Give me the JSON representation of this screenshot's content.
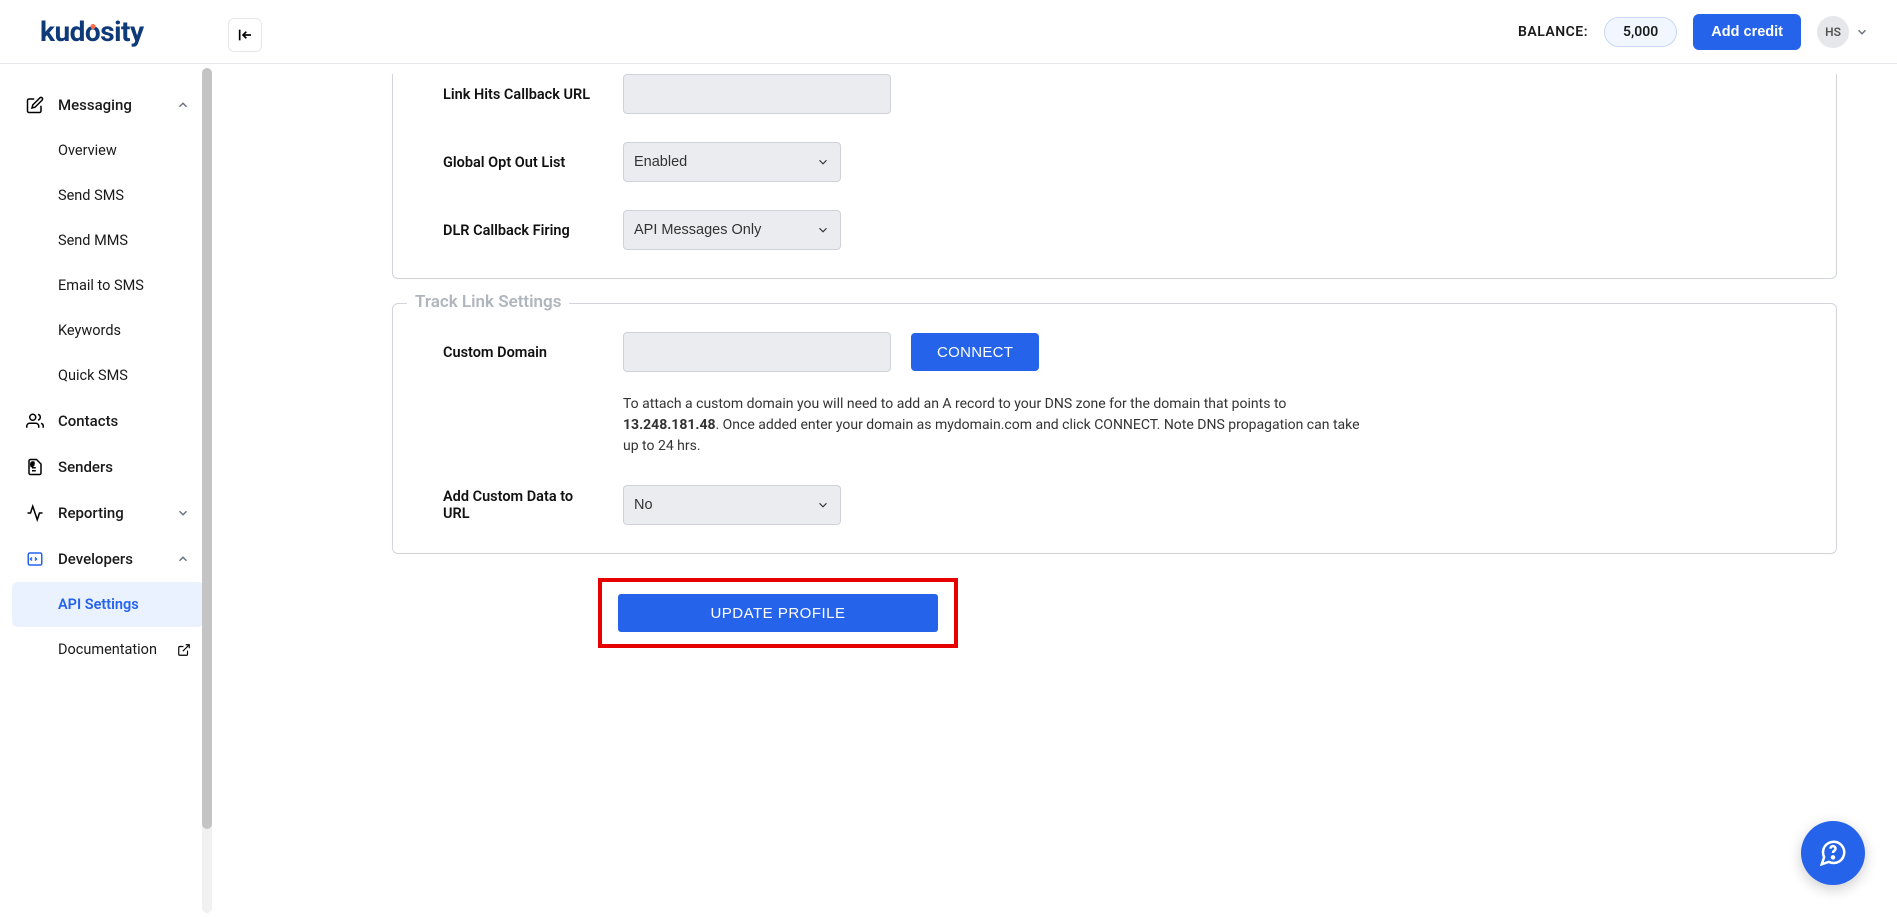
{
  "header": {
    "logo_text": "kudosity",
    "balance_label": "BALANCE:",
    "balance_value": "5,000",
    "add_credit_label": "Add credit",
    "avatar_initials": "HS"
  },
  "sidebar": {
    "messaging": {
      "label": "Messaging",
      "items": [
        "Overview",
        "Send SMS",
        "Send MMS",
        "Email to SMS",
        "Keywords",
        "Quick SMS"
      ]
    },
    "contacts_label": "Contacts",
    "senders_label": "Senders",
    "reporting_label": "Reporting",
    "developers": {
      "label": "Developers",
      "items": [
        "API Settings",
        "Documentation"
      ]
    }
  },
  "form": {
    "link_hits_label": "Link Hits Callback URL",
    "link_hits_value": "",
    "global_optout_label": "Global Opt Out List",
    "global_optout_value": "Enabled",
    "dlr_label": "DLR Callback Firing",
    "dlr_value": "API Messages Only"
  },
  "tracklink": {
    "legend": "Track Link Settings",
    "custom_domain_label": "Custom Domain",
    "custom_domain_value": "",
    "connect_label": "CONNECT",
    "help_pre": "To attach a custom domain you will need to add an A record to your DNS zone for the domain that points to ",
    "help_ip": "13.248.181.48",
    "help_post": ". Once added enter your domain as mydomain.com and click CONNECT. Note DNS propagation can take up to 24 hrs.",
    "add_custom_label": "Add Custom Data to URL",
    "add_custom_value": "No"
  },
  "actions": {
    "update_label": "UPDATE PROFILE"
  }
}
